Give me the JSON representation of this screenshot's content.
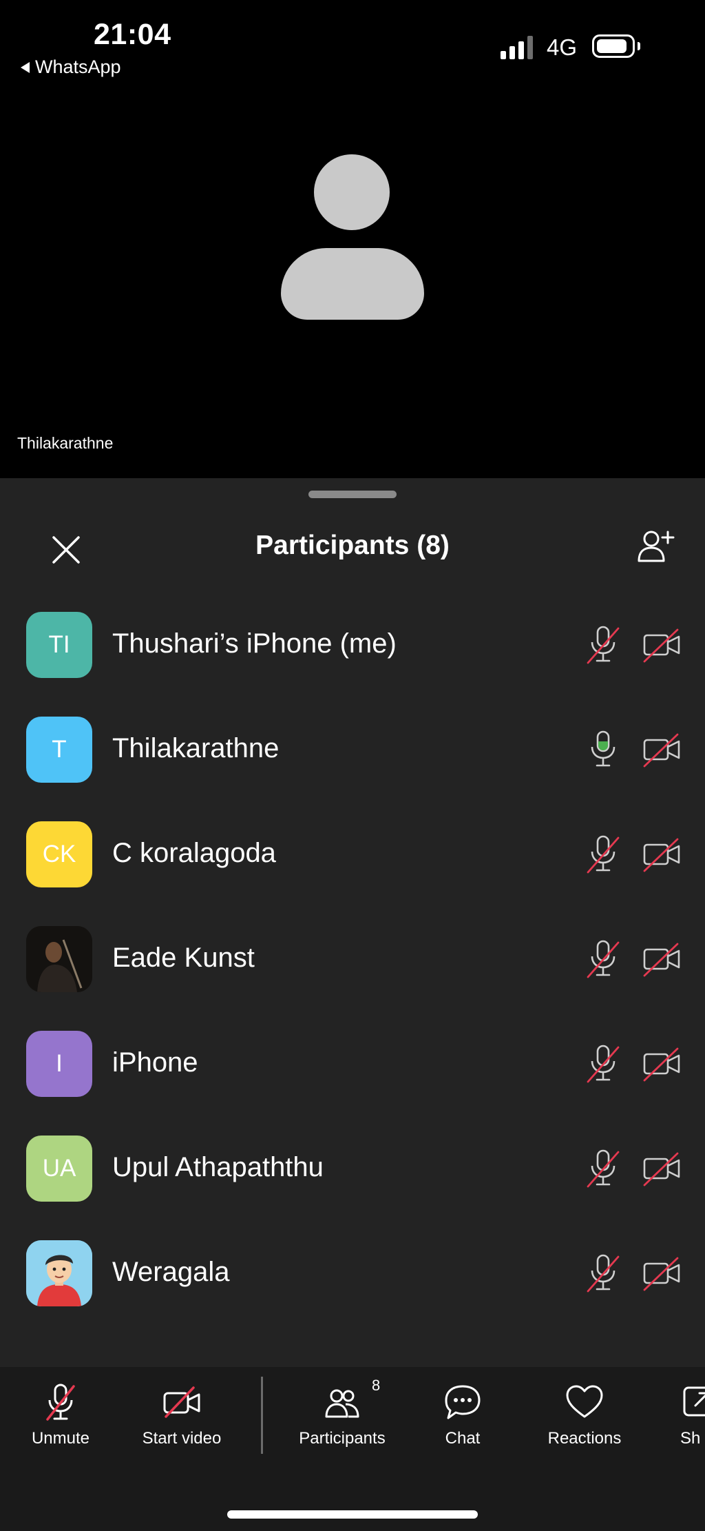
{
  "status_bar": {
    "time": "21:04",
    "back_app": "WhatsApp",
    "network": "4G"
  },
  "video": {
    "speaker_name": "Thilakarathne"
  },
  "panel": {
    "title": "Participants (8)"
  },
  "participants": [
    {
      "initials": "TI",
      "name": "Thushari’s iPhone (me)",
      "color": "#4db6a7",
      "mic": "muted",
      "video": "off"
    },
    {
      "initials": "T",
      "name": "Thilakarathne",
      "color": "#4fc3f7",
      "mic": "on",
      "video": "off"
    },
    {
      "initials": "CK",
      "name": "C koralagoda",
      "color": "#fdd835",
      "mic": "muted",
      "video": "off"
    },
    {
      "initials": "",
      "name": "Eade Kunst",
      "color": "#1c1a18",
      "mic": "muted",
      "video": "off"
    },
    {
      "initials": "I",
      "name": "iPhone",
      "color": "#9575cd",
      "mic": "muted",
      "video": "off"
    },
    {
      "initials": "UA",
      "name": "Upul Athapaththu",
      "color": "#aed581",
      "mic": "muted",
      "video": "off"
    },
    {
      "initials": "",
      "name": "Weragala",
      "color": "#7ec8e3",
      "mic": "muted",
      "video": "off"
    }
  ],
  "toolbar": {
    "unmute": "Unmute",
    "start_video": "Start video",
    "participants": "Participants",
    "participants_count": "8",
    "chat": "Chat",
    "reactions": "Reactions",
    "share": "Sh"
  },
  "colors": {
    "sheet_bg": "#232323",
    "toolbar_bg": "#1a1a1a",
    "mute_slash": "#e53950",
    "mic_active": "#4caf50"
  }
}
